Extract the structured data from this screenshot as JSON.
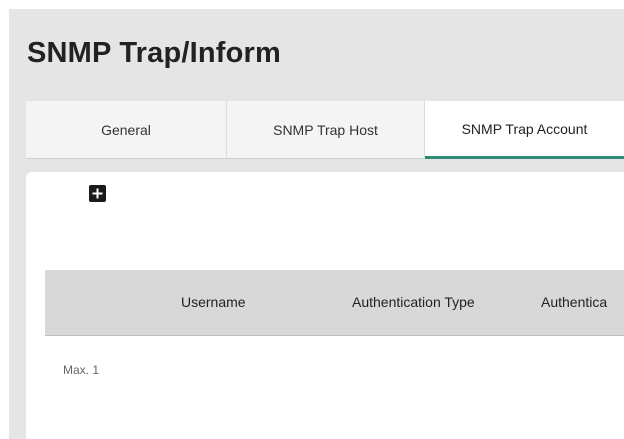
{
  "page": {
    "title": "SNMP Trap/Inform"
  },
  "tabs": [
    {
      "label": "General",
      "active": false
    },
    {
      "label": "SNMP Trap Host",
      "active": false
    },
    {
      "label": "SNMP Trap Account",
      "active": true
    }
  ],
  "toolbar": {
    "add_icon": "plus-icon"
  },
  "table": {
    "columns": [
      "",
      "Username",
      "Authentication Type",
      "Authentica"
    ],
    "rows": []
  },
  "footer": {
    "max_note": "Max. 1"
  },
  "colors": {
    "accent": "#2e8b78",
    "page_background": "#e5e5e5",
    "header_background": "#d8d8d8"
  }
}
